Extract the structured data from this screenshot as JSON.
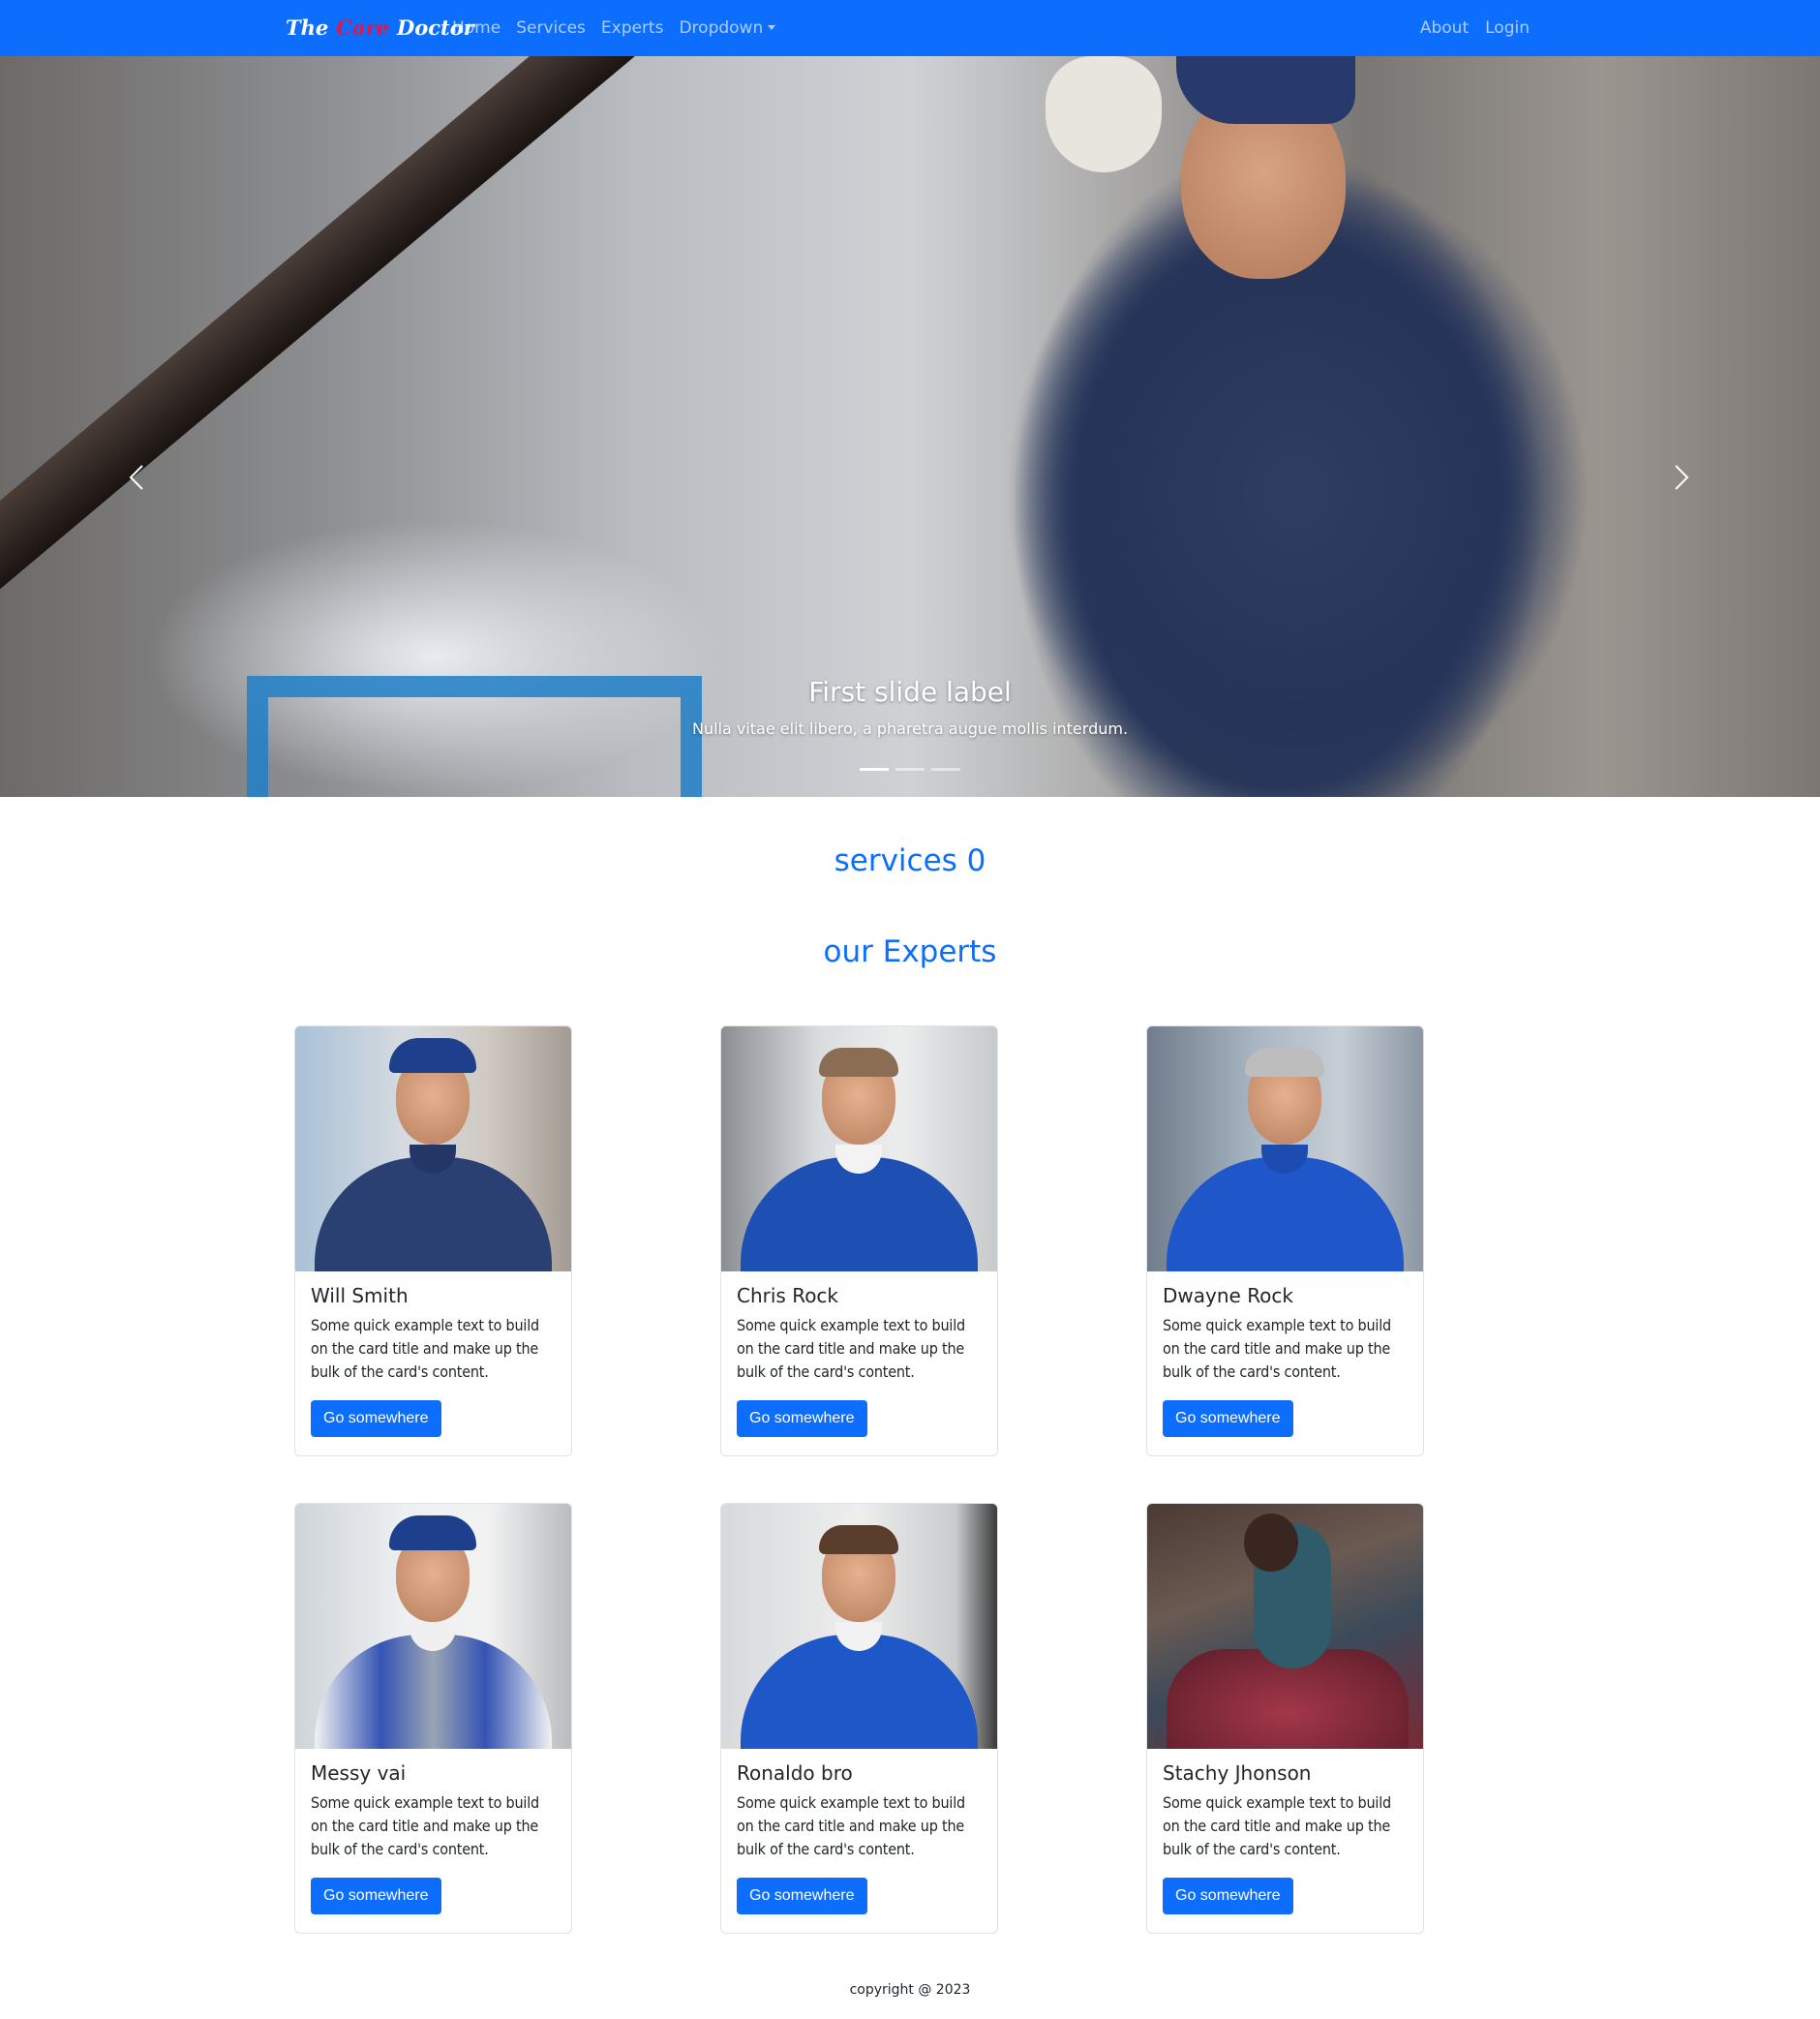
{
  "navbar": {
    "brand": {
      "part1": "The",
      "part2": "Care",
      "part3": "Doctor"
    },
    "left_links": [
      "Home",
      "Services",
      "Experts",
      "Dropdown"
    ],
    "right_links": [
      "About",
      "Login"
    ],
    "bg_color": "#0d6efd"
  },
  "carousel": {
    "caption_title": "First slide label",
    "caption_text": "Nulla vitae elit libero, a pharetra augue mollis interdum.",
    "slide_count": 3,
    "active_slide": 1,
    "prev_icon": "chevron-left-icon",
    "next_icon": "chevron-right-icon"
  },
  "sections": {
    "services_title": "services 0",
    "experts_title": "our Experts"
  },
  "experts": [
    {
      "name": "Will Smith",
      "text": "Some quick example text to build on the card title and make up the bulk of the card's content.",
      "button": "Go somewhere"
    },
    {
      "name": "Chris Rock",
      "text": "Some quick example text to build on the card title and make up the bulk of the card's content.",
      "button": "Go somewhere"
    },
    {
      "name": "Dwayne Rock",
      "text": "Some quick example text to build on the card title and make up the bulk of the card's content.",
      "button": "Go somewhere"
    },
    {
      "name": "Messy vai",
      "text": "Some quick example text to build on the card title and make up the bulk of the card's content.",
      "button": "Go somewhere"
    },
    {
      "name": "Ronaldo bro",
      "text": "Some quick example text to build on the card title and make up the bulk of the card's content.",
      "button": "Go somewhere"
    },
    {
      "name": "Stachy Jhonson",
      "text": "Some quick example text to build on the card title and make up the bulk of the card's content.",
      "button": "Go somewhere"
    }
  ],
  "footer": {
    "text": "copyright @ 2023"
  }
}
